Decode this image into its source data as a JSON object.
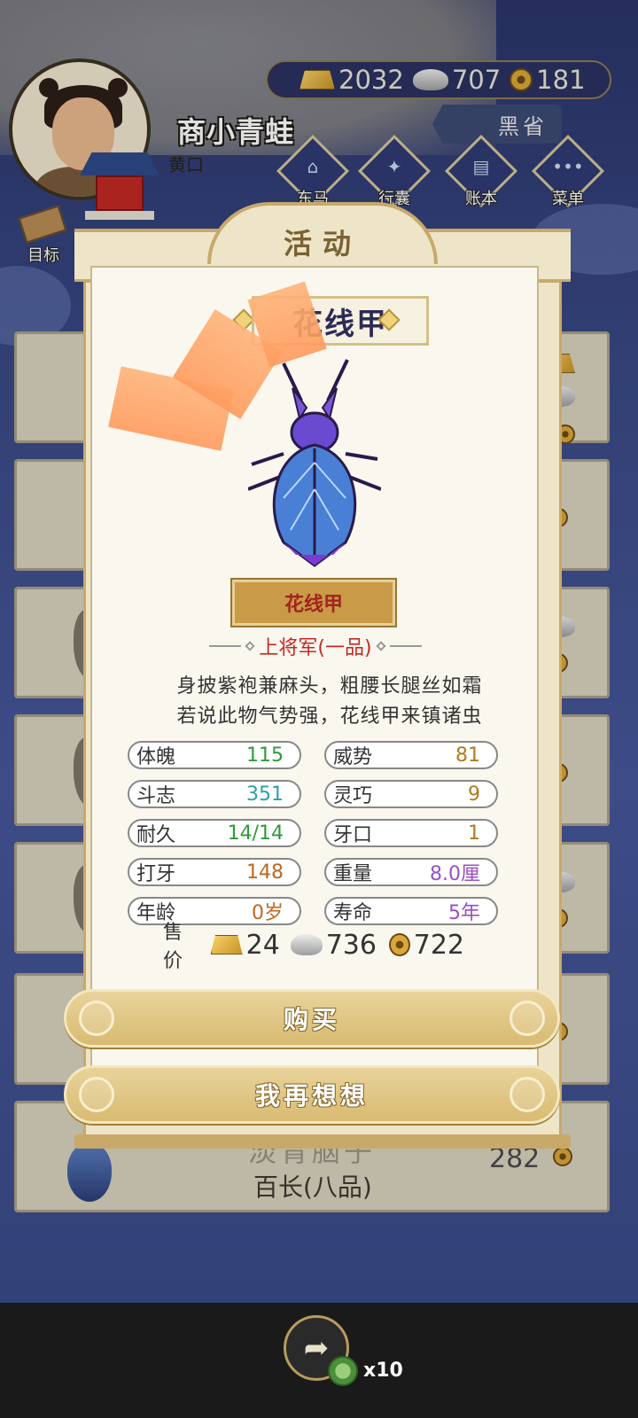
{
  "player": {
    "name": "商小青蛙",
    "rank": "黄口"
  },
  "currency": {
    "gold": "2032",
    "silver": "707",
    "coins": "181"
  },
  "location": "黑省",
  "nav": {
    "shop": "东马",
    "bag": "行囊",
    "ledger": "账本",
    "menu": "菜单",
    "target": "目标"
  },
  "background_list": {
    "last_item_title": "淡青脑子",
    "last_item_rank": "百长(八品)",
    "last_item_value": "282"
  },
  "modal": {
    "title": "活动",
    "insect_name_header": "花线甲",
    "insect_nameplate": "花线甲",
    "grade": "上将军(一品)",
    "description_line1": "身披紫袍兼麻头，粗腰长腿丝如霜",
    "description_line2": "若说此物气势强，花线甲来镇诸虫",
    "stats": {
      "physique_label": "体魄",
      "physique_value": "115",
      "might_label": "威势",
      "might_value": "81",
      "spirit_label": "斗志",
      "spirit_value": "351",
      "agility_label": "灵巧",
      "agility_value": "9",
      "durability_label": "耐久",
      "durability_value": "14/14",
      "teeth_label": "牙口",
      "teeth_value": "1",
      "bite_label": "打牙",
      "bite_value": "148",
      "weight_label": "重量",
      "weight_value": "8.0厘",
      "age_label": "年龄",
      "age_value": "0岁",
      "lifespan_label": "寿命",
      "lifespan_value": "5年"
    },
    "price_label": "售价",
    "price_gold": "24",
    "price_silver": "736",
    "price_coins": "722",
    "buy_button": "购买",
    "reconsider_button": "我再想想"
  },
  "bottom": {
    "reward_count": "x10"
  },
  "colors": {
    "stat_green": "#2e9a3a",
    "stat_teal": "#2ba0a8",
    "stat_orange": "#c0661f",
    "stat_brown": "#b07a1e",
    "stat_purple": "#9a4fc4",
    "grade_red": "#c42a23"
  }
}
